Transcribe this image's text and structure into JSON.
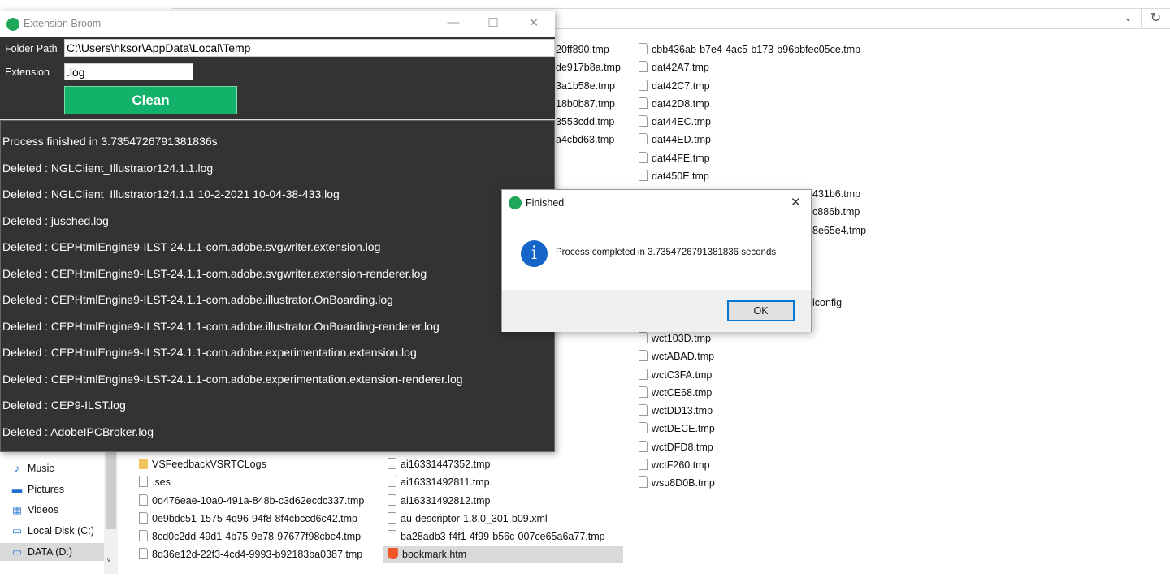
{
  "explorer": {
    "address_chevron": "⌄",
    "refresh_icon": "↻",
    "col2_partial": [
      "20ff890.tmp",
      "de917b8a.tmp",
      "3a1b58e.tmp",
      "18b0b87.tmp",
      "3553cdd.tmp",
      "a4cbd63.tmp"
    ],
    "col3": [
      "cbb436ab-b7e4-4ac5-b173-b96bbfec05ce.tmp",
      "dat42A7.tmp",
      "dat42C7.tmp",
      "dat42D8.tmp",
      "dat44EC.tmp",
      "dat44ED.tmp",
      "dat44FE.tmp",
      "dat450E.tmp"
    ],
    "col3_partial": [
      "431b6.tmp",
      "c886b.tmp",
      "8e65e4.tmp",
      "lconfig"
    ],
    "col3_lower": [
      "wct103D.tmp",
      "wctABAD.tmp",
      "wctC3FA.tmp",
      "wctCE68.tmp",
      "wctDD13.tmp",
      "wctDECE.tmp",
      "wctDFD8.tmp",
      "wctF260.tmp",
      "wsu8D0B.tmp"
    ],
    "col1_bottom": [
      {
        "name": "VSFeedbackVSRTCLogs",
        "type": "folder"
      },
      {
        "name": ".ses",
        "type": "file"
      },
      {
        "name": "0d476eae-10a0-491a-848b-c3d62ecdc337.tmp",
        "type": "file"
      },
      {
        "name": "0e9bdc51-1575-4d96-94f8-8f4cbccd6c42.tmp",
        "type": "file"
      },
      {
        "name": "8cd0c2dd-49d1-4b75-9e78-97677f98cbc4.tmp",
        "type": "file"
      },
      {
        "name": "8d36e12d-22f3-4cd4-9993-b92183ba0387.tmp",
        "type": "file"
      }
    ],
    "col2_bottom": [
      {
        "name": "ai16331447352.tmp",
        "type": "file"
      },
      {
        "name": "ai16331492811.tmp",
        "type": "file"
      },
      {
        "name": "ai16331492812.tmp",
        "type": "file"
      },
      {
        "name": "au-descriptor-1.8.0_301-b09.xml",
        "type": "file"
      },
      {
        "name": "ba28adb3-f4f1-4f99-b56c-007ce65a6a77.tmp",
        "type": "file"
      },
      {
        "name": "bookmark.htm",
        "type": "brave",
        "selected": true
      }
    ],
    "sidebar": [
      {
        "label": "Music",
        "icon": "music-icon",
        "glyph": "♪"
      },
      {
        "label": "Pictures",
        "icon": "pictures-icon",
        "glyph": "▬"
      },
      {
        "label": "Videos",
        "icon": "videos-icon",
        "glyph": "▦"
      },
      {
        "label": "Local Disk (C:)",
        "icon": "drive-icon",
        "glyph": "▭"
      },
      {
        "label": "DATA (D:)",
        "icon": "drive-icon",
        "glyph": "▭",
        "selected": true
      }
    ]
  },
  "app": {
    "title": "Extension Broom",
    "folder_label": "Folder Path",
    "folder_value": "C:\\Users\\hksor\\AppData\\Local\\Temp",
    "ext_label": "Extension",
    "ext_value": ".log",
    "clean_label": "Clean",
    "accent": "#13b26a",
    "log": [
      "Process finished in 3.7354726791381836s",
      "Deleted : NGLClient_Illustrator124.1.1.log",
      "Deleted : NGLClient_Illustrator124.1.1 10-2-2021 10-04-38-433.log",
      "Deleted : jusched.log",
      "Deleted : CEPHtmlEngine9-ILST-24.1.1-com.adobe.svgwriter.extension.log",
      "Deleted : CEPHtmlEngine9-ILST-24.1.1-com.adobe.svgwriter.extension-renderer.log",
      "Deleted : CEPHtmlEngine9-ILST-24.1.1-com.adobe.illustrator.OnBoarding.log",
      "Deleted : CEPHtmlEngine9-ILST-24.1.1-com.adobe.illustrator.OnBoarding-renderer.log",
      "Deleted : CEPHtmlEngine9-ILST-24.1.1-com.adobe.experimentation.extension.log",
      "Deleted : CEPHtmlEngine9-ILST-24.1.1-com.adobe.experimentation.extension-renderer.log",
      "Deleted : CEP9-ILST.log",
      "Deleted : AdobeIPCBroker.log"
    ]
  },
  "dialog": {
    "title": "Finished",
    "message": "Process completed in 3.7354726791381836 seconds",
    "ok_label": "OK",
    "info_glyph": "i",
    "close_glyph": "✕"
  }
}
